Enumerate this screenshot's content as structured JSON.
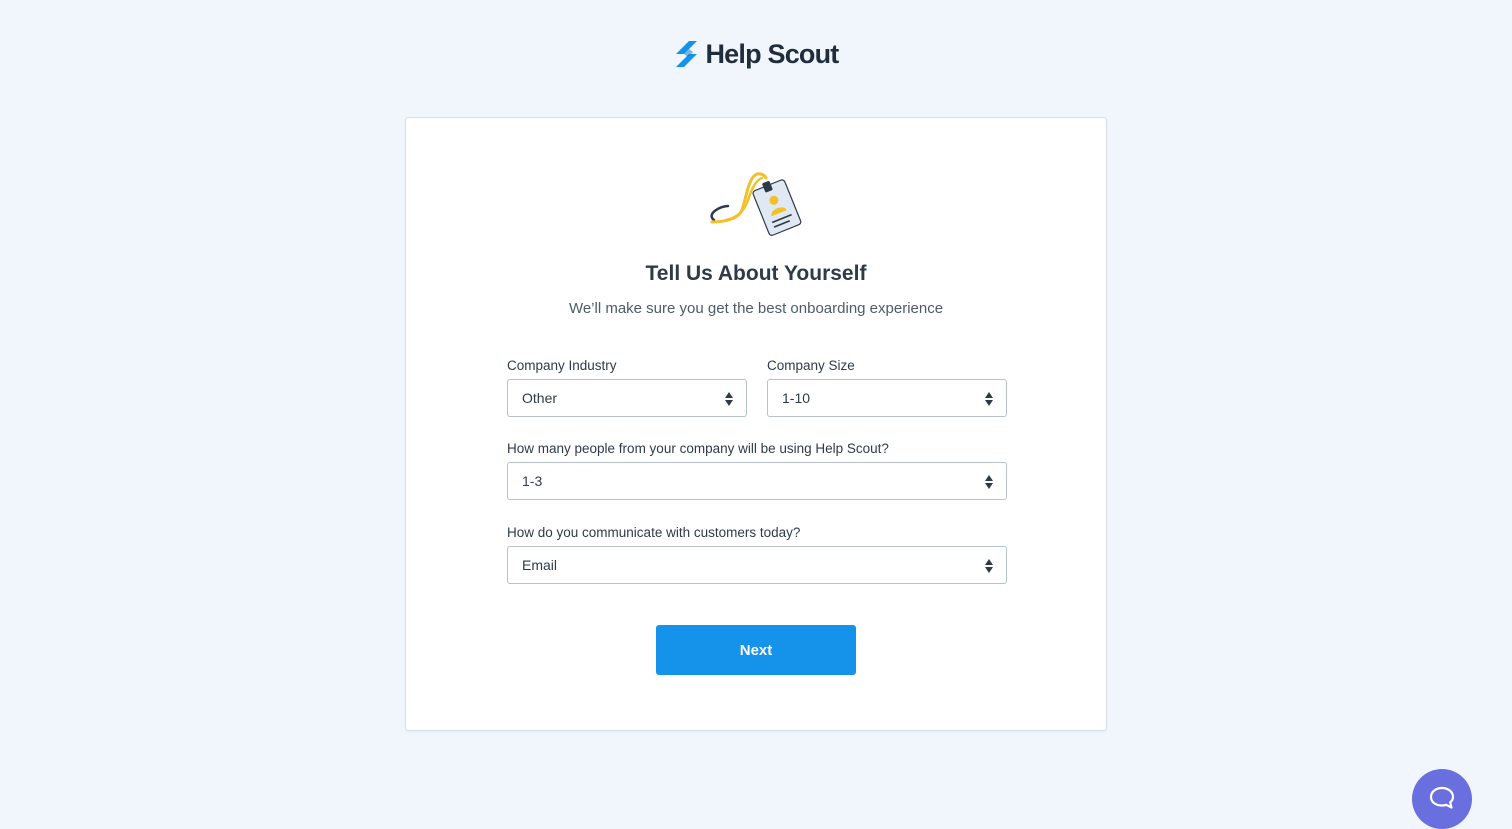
{
  "brand": {
    "name": "Help Scout",
    "logo_icon": "help-scout-logo-icon",
    "accent_color": "#1592ea"
  },
  "form": {
    "title": "Tell Us About Yourself",
    "subtitle": "We’ll make sure you get the best onboarding experience",
    "industry": {
      "label": "Company Industry",
      "value": "Other"
    },
    "size": {
      "label": "Company Size",
      "value": "1-10"
    },
    "users": {
      "label": "How many people from your company will be using Help Scout?",
      "value": "1-3"
    },
    "channel": {
      "label": "How do you communicate with customers today?",
      "value": "Email"
    },
    "next_label": "Next"
  },
  "beacon": {
    "icon": "chat-bubble-icon",
    "color": "#6a6fe0"
  }
}
